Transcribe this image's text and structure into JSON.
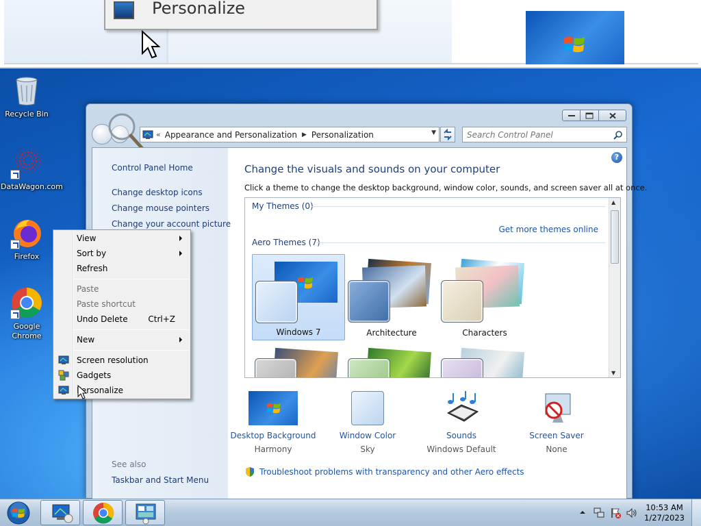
{
  "zoom": {
    "menu_label": "Personalize"
  },
  "desktop": {
    "icons": [
      {
        "label": "Recycle Bin"
      },
      {
        "label": "DataWagon.com"
      },
      {
        "label": "Firefox"
      },
      {
        "label": "Google Chrome"
      }
    ]
  },
  "window": {
    "breadcrumb_root": "Appearance and Personalization",
    "breadcrumb_current": "Personalization",
    "search_placeholder": "Search Control Panel",
    "sidebar": {
      "home": "Control Panel Home",
      "links": [
        "Change desktop icons",
        "Change mouse pointers",
        "Change your account picture"
      ],
      "see_also_label": "See also",
      "see_also_links": [
        "Taskbar and Start Menu"
      ]
    },
    "main": {
      "title": "Change the visuals and sounds on your computer",
      "description": "Click a theme to change the desktop background, window color, sounds, and screen saver all at once.",
      "my_themes": "My Themes (0)",
      "get_more": "Get more themes online",
      "aero_themes": "Aero Themes (7)",
      "themes": [
        {
          "name": "Windows 7",
          "selected": true
        },
        {
          "name": "Architecture",
          "selected": false
        },
        {
          "name": "Characters",
          "selected": false
        }
      ],
      "bottom": [
        {
          "name": "Desktop Background",
          "value": "Harmony"
        },
        {
          "name": "Window Color",
          "value": "Sky"
        },
        {
          "name": "Sounds",
          "value": "Windows Default"
        },
        {
          "name": "Screen Saver",
          "value": "None"
        }
      ],
      "troubleshoot": "Troubleshoot problems with transparency and other Aero effects"
    }
  },
  "context_menu": {
    "items": [
      {
        "label": "View",
        "submenu": true,
        "disabled": false
      },
      {
        "label": "Sort by",
        "submenu": true,
        "disabled": false
      },
      {
        "label": "Refresh",
        "disabled": false
      },
      {
        "label": "Paste",
        "disabled": true
      },
      {
        "label": "Paste shortcut",
        "disabled": true
      },
      {
        "label": "Undo Delete",
        "shortcut": "Ctrl+Z",
        "disabled": false
      },
      {
        "label": "New",
        "submenu": true,
        "disabled": false
      },
      {
        "label": "Screen resolution",
        "icon": "monitor-icon",
        "disabled": false
      },
      {
        "label": "Gadgets",
        "icon": "gadgets-icon",
        "disabled": false
      },
      {
        "label": "Personalize",
        "icon": "personalize-icon",
        "disabled": false
      }
    ]
  },
  "taskbar": {
    "time": "10:53 AM",
    "date": "1/27/2023",
    "pinned": [
      "Control Panel",
      "Google Chrome",
      "Gadgets"
    ]
  },
  "colors": {
    "link": "#1e55a8",
    "title": "#1e3f7e",
    "desktop": "#1869d2"
  }
}
